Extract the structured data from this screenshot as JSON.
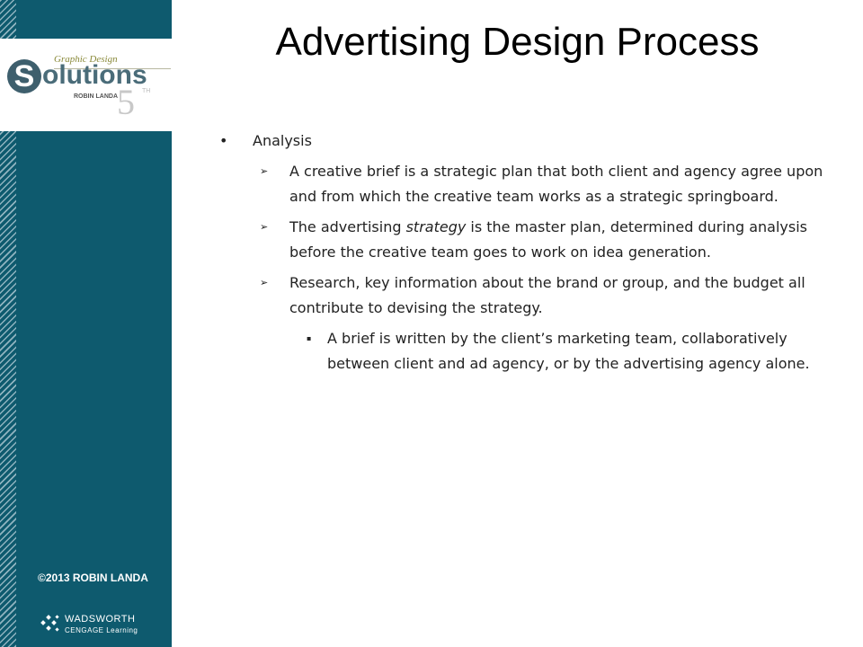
{
  "slide": {
    "title": "Advertising Design Process",
    "bullets": [
      {
        "level": 1,
        "text": "Analysis"
      },
      {
        "level": 2,
        "text": "A creative brief is a strategic plan that both client and agency agree upon and from which the creative team works as a strategic springboard."
      },
      {
        "level": 2,
        "text_before": "The advertising ",
        "emphasis": "strategy",
        "text_after": " is the master plan, determined during analysis before the creative team goes to work on idea generation."
      },
      {
        "level": 2,
        "text": "Research, key information about the brand or group, and the budget all contribute to devising the strategy."
      },
      {
        "level": 3,
        "text": "A brief is written by the client’s marketing team, collaboratively between client and ad agency, or by the advertising agency alone."
      }
    ]
  },
  "sidebar": {
    "logo": {
      "kicker": "Graphic Design",
      "word": "olutions",
      "initial": "S",
      "author": "ROBIN LANDA",
      "edition": "5",
      "edition_suffix": "TH"
    },
    "copyright": "©2013 ROBIN LANDA",
    "publisher": {
      "name": "WADSWORTH",
      "sub": "CENGAGE Learning"
    }
  },
  "colors": {
    "sidebar": "#0e5a6e",
    "logo_accent": "#4a6c79"
  },
  "markers": {
    "level1": "•",
    "level2": "➢",
    "level3": "▪"
  }
}
